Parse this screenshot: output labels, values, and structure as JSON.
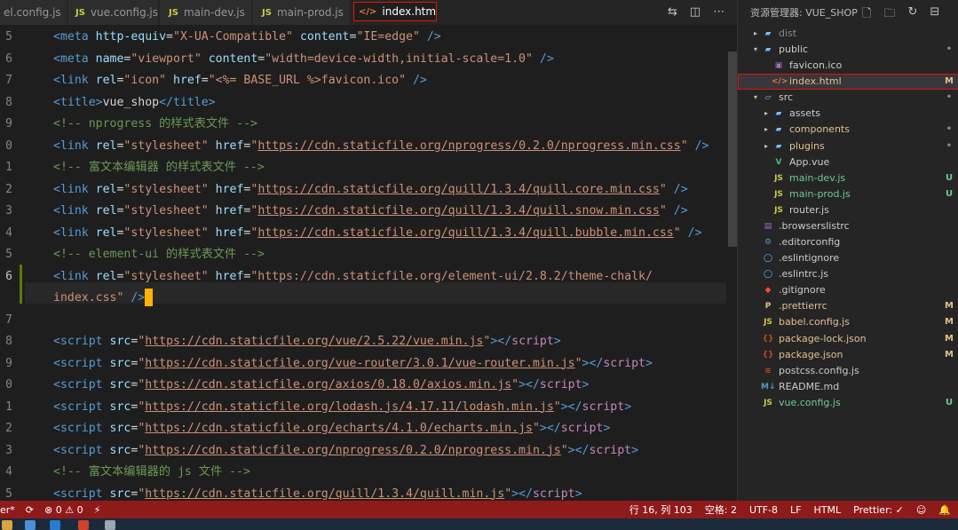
{
  "tabs": [
    {
      "icon": "JS",
      "label": "el.config.js"
    },
    {
      "icon": "JS",
      "label": "vue.config.js"
    },
    {
      "icon": "JS",
      "label": "main-dev.js"
    },
    {
      "icon": "JS",
      "label": "main-prod.js"
    },
    {
      "icon": "</>",
      "label": "index.html"
    }
  ],
  "explorer": {
    "title": "资源管理器: VUE_SHOP",
    "items": [
      {
        "name": "dist",
        "badge": ""
      },
      {
        "name": "public",
        "badge": "•"
      },
      {
        "name": "favicon.ico",
        "badge": ""
      },
      {
        "name": "index.html",
        "badge": "M"
      },
      {
        "name": "src",
        "badge": "•"
      },
      {
        "name": "assets",
        "badge": ""
      },
      {
        "name": "components",
        "badge": "•"
      },
      {
        "name": "plugins",
        "badge": "•"
      },
      {
        "name": "App.vue",
        "badge": ""
      },
      {
        "name": "main-dev.js",
        "badge": "U"
      },
      {
        "name": "main-prod.js",
        "badge": "U"
      },
      {
        "name": "router.js",
        "badge": ""
      },
      {
        "name": ".browserslistrc",
        "badge": ""
      },
      {
        "name": ".editorconfig",
        "badge": ""
      },
      {
        "name": ".eslintignore",
        "badge": ""
      },
      {
        "name": ".eslintrc.js",
        "badge": ""
      },
      {
        "name": ".gitignore",
        "badge": ""
      },
      {
        "name": ".prettierrc",
        "badge": "M"
      },
      {
        "name": "babel.config.js",
        "badge": "M"
      },
      {
        "name": "package-lock.json",
        "badge": "M"
      },
      {
        "name": "package.json",
        "badge": "M"
      },
      {
        "name": "postcss.config.js",
        "badge": ""
      },
      {
        "name": "README.md",
        "badge": ""
      },
      {
        "name": "vue.config.js",
        "badge": "U"
      }
    ]
  },
  "editor": {
    "line_numbers": [
      "5",
      "6",
      "7",
      "8",
      "9",
      "0",
      "1",
      "2",
      "3",
      "4",
      "5",
      "6",
      "",
      "7",
      "8",
      "9",
      "0",
      "1",
      "2",
      "3",
      "4",
      "5"
    ],
    "lines": [
      {
        "parts": [
          [
            "tg",
            "<meta "
          ],
          [
            "at",
            "http-equiv"
          ],
          [
            "",
            "="
          ],
          [
            "st",
            "\"X-UA-Compatible\" "
          ],
          [
            "at",
            "content"
          ],
          [
            "",
            "="
          ],
          [
            "st",
            "\"IE=edge\""
          ],
          [
            "tg",
            " />"
          ]
        ]
      },
      {
        "parts": [
          [
            "tg",
            "<meta "
          ],
          [
            "at",
            "name"
          ],
          [
            "",
            "="
          ],
          [
            "st",
            "\"viewport\" "
          ],
          [
            "at",
            "content"
          ],
          [
            "",
            "="
          ],
          [
            "st",
            "\"width=device-width,initial-scale=1.0\""
          ],
          [
            "tg",
            " />"
          ]
        ]
      },
      {
        "parts": [
          [
            "tg",
            "<link "
          ],
          [
            "at",
            "rel"
          ],
          [
            "",
            "="
          ],
          [
            "st",
            "\"icon\" "
          ],
          [
            "at",
            "href"
          ],
          [
            "",
            "="
          ],
          [
            "st",
            "\"<%= BASE_URL %>favicon.ico\""
          ],
          [
            "tg",
            " />"
          ]
        ]
      },
      {
        "parts": [
          [
            "tg",
            "<title>"
          ],
          [
            "",
            "vue_shop"
          ],
          [
            "tg",
            "</title>"
          ]
        ]
      },
      {
        "parts": [
          [
            "cm",
            "<!-- nprogress 的样式表文件 -->"
          ]
        ]
      },
      {
        "parts": [
          [
            "tg",
            "<link "
          ],
          [
            "at",
            "rel"
          ],
          [
            "",
            "="
          ],
          [
            "st",
            "\"stylesheet\" "
          ],
          [
            "at",
            "href"
          ],
          [
            "",
            "="
          ],
          [
            "st",
            "\""
          ],
          [
            "ur",
            "https://cdn.staticfile.org/nprogress/0.2.0/nprogress.min.css"
          ],
          [
            "st",
            "\""
          ],
          [
            "tg",
            " />"
          ]
        ]
      },
      {
        "parts": [
          [
            "cm",
            "<!-- 富文本编辑器 的样式表文件 -->"
          ]
        ]
      },
      {
        "parts": [
          [
            "tg",
            "<link "
          ],
          [
            "at",
            "rel"
          ],
          [
            "",
            "="
          ],
          [
            "st",
            "\"stylesheet\" "
          ],
          [
            "at",
            "href"
          ],
          [
            "",
            "="
          ],
          [
            "st",
            "\""
          ],
          [
            "ur",
            "https://cdn.staticfile.org/quill/1.3.4/quill.core.min.css"
          ],
          [
            "st",
            "\""
          ],
          [
            "tg",
            " />"
          ]
        ]
      },
      {
        "parts": [
          [
            "tg",
            "<link "
          ],
          [
            "at",
            "rel"
          ],
          [
            "",
            "="
          ],
          [
            "st",
            "\"stylesheet\" "
          ],
          [
            "at",
            "href"
          ],
          [
            "",
            "="
          ],
          [
            "st",
            "\""
          ],
          [
            "ur",
            "https://cdn.staticfile.org/quill/1.3.4/quill.snow.min.css"
          ],
          [
            "st",
            "\""
          ],
          [
            "tg",
            " />"
          ]
        ]
      },
      {
        "parts": [
          [
            "tg",
            "<link "
          ],
          [
            "at",
            "rel"
          ],
          [
            "",
            "="
          ],
          [
            "st",
            "\"stylesheet\" "
          ],
          [
            "at",
            "href"
          ],
          [
            "",
            "="
          ],
          [
            "st",
            "\""
          ],
          [
            "ur",
            "https://cdn.staticfile.org/quill/1.3.4/quill.bubble.min.css"
          ],
          [
            "st",
            "\""
          ],
          [
            "tg",
            " />"
          ]
        ]
      },
      {
        "parts": [
          [
            "cm",
            "<!-- element-ui 的样式表文件 -->"
          ]
        ]
      },
      {
        "parts": [
          [
            "tg",
            "<link "
          ],
          [
            "at",
            "rel"
          ],
          [
            "",
            "="
          ],
          [
            "st",
            "\"stylesheet\" "
          ],
          [
            "at",
            "href"
          ],
          [
            "",
            "="
          ],
          [
            "st",
            "\"https://cdn.staticfile.org/element-ui/2.8.2/theme-chalk/"
          ]
        ]
      },
      {
        "parts": [
          [
            "st",
            "index.css\""
          ],
          [
            "tg",
            " />"
          ]
        ]
      },
      {
        "parts": []
      },
      {
        "parts": [
          [
            "tg",
            "<script "
          ],
          [
            "at",
            "src"
          ],
          [
            "",
            "="
          ],
          [
            "st",
            "\""
          ],
          [
            "ur",
            "https://cdn.staticfile.org/vue/2.5.22/vue.min.js"
          ],
          [
            "st",
            "\""
          ],
          [
            "tg",
            "></"
          ],
          [
            "sc",
            "script"
          ],
          [
            "tg",
            ">"
          ]
        ]
      },
      {
        "parts": [
          [
            "tg",
            "<script "
          ],
          [
            "at",
            "src"
          ],
          [
            "",
            "="
          ],
          [
            "st",
            "\""
          ],
          [
            "ur",
            "https://cdn.staticfile.org/vue-router/3.0.1/vue-router.min.js"
          ],
          [
            "st",
            "\""
          ],
          [
            "tg",
            "></"
          ],
          [
            "sc",
            "script"
          ],
          [
            "tg",
            ">"
          ]
        ]
      },
      {
        "parts": [
          [
            "tg",
            "<script "
          ],
          [
            "at",
            "src"
          ],
          [
            "",
            "="
          ],
          [
            "st",
            "\""
          ],
          [
            "ur",
            "https://cdn.staticfile.org/axios/0.18.0/axios.min.js"
          ],
          [
            "st",
            "\""
          ],
          [
            "tg",
            "></"
          ],
          [
            "sc",
            "script"
          ],
          [
            "tg",
            ">"
          ]
        ]
      },
      {
        "parts": [
          [
            "tg",
            "<script "
          ],
          [
            "at",
            "src"
          ],
          [
            "",
            "="
          ],
          [
            "st",
            "\""
          ],
          [
            "ur",
            "https://cdn.staticfile.org/lodash.js/4.17.11/lodash.min.js"
          ],
          [
            "st",
            "\""
          ],
          [
            "tg",
            "></"
          ],
          [
            "sc",
            "script"
          ],
          [
            "tg",
            ">"
          ]
        ]
      },
      {
        "parts": [
          [
            "tg",
            "<script "
          ],
          [
            "at",
            "src"
          ],
          [
            "",
            "="
          ],
          [
            "st",
            "\""
          ],
          [
            "ur",
            "https://cdn.staticfile.org/echarts/4.1.0/echarts.min.js"
          ],
          [
            "st",
            "\""
          ],
          [
            "tg",
            "></"
          ],
          [
            "sc",
            "script"
          ],
          [
            "tg",
            ">"
          ]
        ]
      },
      {
        "parts": [
          [
            "tg",
            "<script "
          ],
          [
            "at",
            "src"
          ],
          [
            "",
            "="
          ],
          [
            "st",
            "\""
          ],
          [
            "ur",
            "https://cdn.staticfile.org/nprogress/0.2.0/nprogress.min.js"
          ],
          [
            "st",
            "\""
          ],
          [
            "tg",
            "></"
          ],
          [
            "sc",
            "script"
          ],
          [
            "tg",
            ">"
          ]
        ]
      },
      {
        "parts": [
          [
            "cm",
            "<!-- 富文本编辑器的 js 文件 -->"
          ]
        ]
      },
      {
        "parts": [
          [
            "tg",
            "<script "
          ],
          [
            "at",
            "src"
          ],
          [
            "",
            "="
          ],
          [
            "st",
            "\""
          ],
          [
            "ur",
            "https://cdn.staticfile.org/quill/1.3.4/quill.min.js"
          ],
          [
            "st",
            "\""
          ],
          [
            "tg",
            "></"
          ],
          [
            "sc",
            "script"
          ],
          [
            "tg",
            ">"
          ]
        ]
      }
    ]
  },
  "statusbar": {
    "left_text": "er*",
    "problems": "⊗ 0 ⚠ 0",
    "cursor_position": "行 16, 列 103",
    "indent": "空格: 2",
    "encoding": "UTF-8",
    "eol": "LF",
    "language": "HTML",
    "formatter": "Prettier: ✓"
  },
  "colors": {
    "statusbar": "#8f1a1a",
    "highlight_outline": "#e51400",
    "cursor": "#ffb300"
  }
}
